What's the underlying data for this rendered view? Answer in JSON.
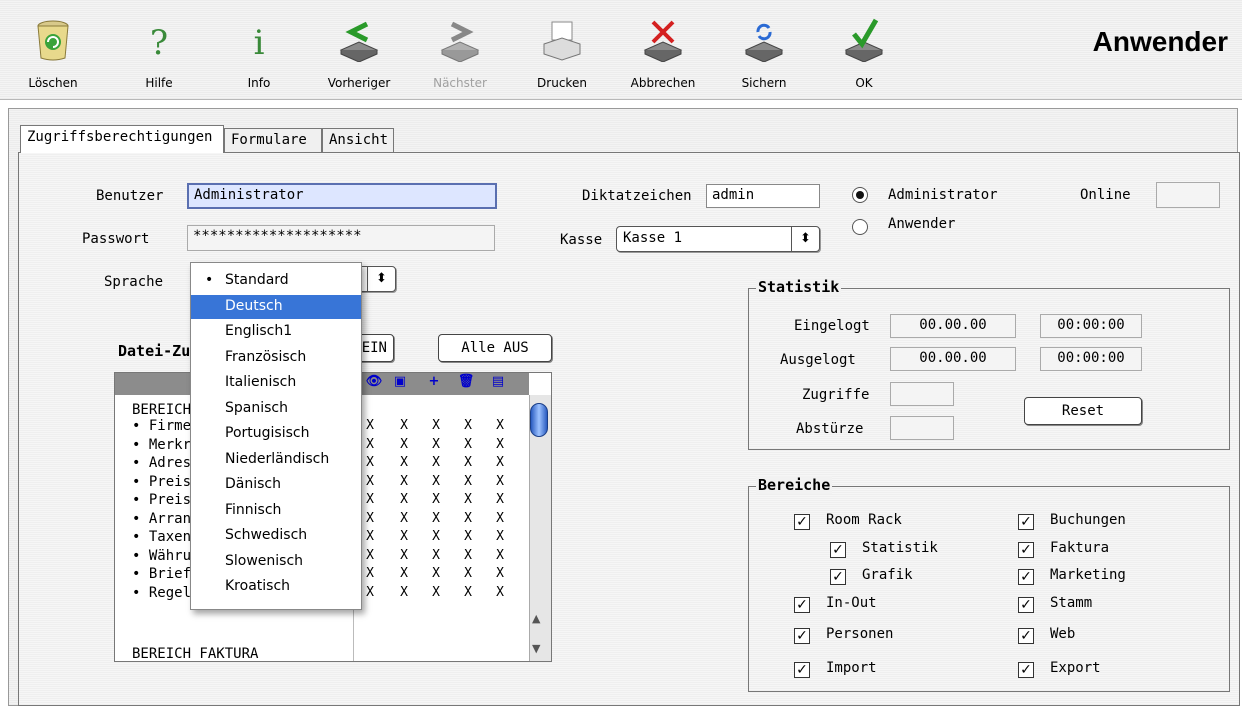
{
  "window": {
    "title": "Anwender"
  },
  "toolbar": [
    {
      "label": "Löschen",
      "icon": "trash-icon",
      "enabled": true
    },
    {
      "label": "Hilfe",
      "icon": "help-icon",
      "enabled": true
    },
    {
      "label": "Info",
      "icon": "info-icon",
      "enabled": true
    },
    {
      "label": "Vorheriger",
      "icon": "previous-icon",
      "enabled": true
    },
    {
      "label": "Nächster",
      "icon": "next-icon",
      "enabled": false
    },
    {
      "label": "Drucken",
      "icon": "printer-icon",
      "enabled": true
    },
    {
      "label": "Abbrechen",
      "icon": "cancel-icon",
      "enabled": true
    },
    {
      "label": "Sichern",
      "icon": "save-icon",
      "enabled": true
    },
    {
      "label": "OK",
      "icon": "ok-icon",
      "enabled": true
    }
  ],
  "tabs": [
    {
      "label": "Zugriffsberechtigungen",
      "active": true
    },
    {
      "label": "Formulare",
      "active": false
    },
    {
      "label": "Ansicht",
      "active": false
    }
  ],
  "form": {
    "benutzer_label": "Benutzer",
    "benutzer_value": "Administrator",
    "passwort_label": "Passwort",
    "passwort_value": "********************",
    "sprache_label": "Sprache",
    "diktat_label": "Diktatzeichen",
    "diktat_value": "admin",
    "kasse_label": "Kasse",
    "kasse_value": "Kasse 1",
    "role_admin": "Administrator",
    "role_user": "Anwender",
    "selected_role": "Administrator",
    "online_label": "Online",
    "online_value": ""
  },
  "statistik": {
    "title": "Statistik",
    "eingelogt_label": "Eingelogt",
    "eingelogt_date": "00.00.00",
    "eingelogt_time": "00:00:00",
    "ausgelogt_label": "Ausgelogt",
    "ausgelogt_date": "00.00.00",
    "ausgelogt_time": "00:00:00",
    "zugriffe_label": "Zugriffe",
    "abstuerze_label": "Abstürze",
    "reset_label": "Reset"
  },
  "bereiche": {
    "title": "Bereiche",
    "items": [
      {
        "label": "Room Rack",
        "checked": true
      },
      {
        "label": "Statistik",
        "checked": true
      },
      {
        "label": "Grafik",
        "checked": true
      },
      {
        "label": "In-Out",
        "checked": true
      },
      {
        "label": "Personen",
        "checked": true
      },
      {
        "label": "Import",
        "checked": true
      },
      {
        "label": "Buchungen",
        "checked": true
      },
      {
        "label": "Faktura",
        "checked": true
      },
      {
        "label": "Marketing",
        "checked": true
      },
      {
        "label": "Stamm",
        "checked": true
      },
      {
        "label": "Web",
        "checked": true
      },
      {
        "label": "Export",
        "checked": true
      }
    ]
  },
  "datei": {
    "title_visible": "Datei-Zu",
    "alle_ein_visible": "EIN",
    "alle_aus": "Alle AUS",
    "column_icons": [
      "view-icon",
      "save-icon",
      "add-icon",
      "delete-icon",
      "document-icon"
    ],
    "section1": "BEREICH",
    "rows": [
      "• Firme",
      "• Merkr",
      "• Adress",
      "• Preisl",
      "• Preise",
      "• Arran",
      "• Taxen",
      "• Währu",
      "• Briefe",
      "• Regeln"
    ],
    "mark": "X",
    "section2": "BEREICH FAKTURA"
  },
  "language_menu": {
    "current": "Standard",
    "highlighted": "Deutsch",
    "options": [
      "Standard",
      "Deutsch",
      "Englisch1",
      "Französisch",
      "Italienisch",
      "Spanisch",
      "Portugisisch",
      "Niederländisch",
      "Dänisch",
      "Finnisch",
      "Schwedisch",
      "Slowenisch",
      "Kroatisch"
    ]
  }
}
